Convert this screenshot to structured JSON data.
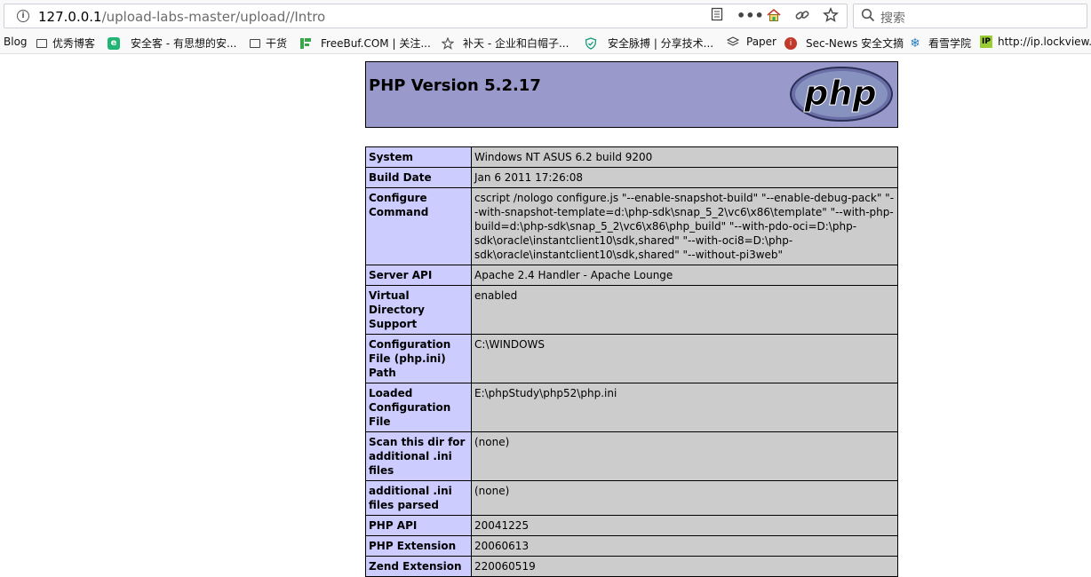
{
  "browser": {
    "url_host": "127.0.0.1",
    "url_path": "/upload-labs-master/upload//Intro",
    "search_placeholder": "搜索",
    "bookmarks": [
      {
        "label": "Blog",
        "icon": "none"
      },
      {
        "label": "优秀博客",
        "icon": "folder-icon"
      },
      {
        "label": "安全客 - 有思想的安...",
        "icon": "anquanke-icon"
      },
      {
        "label": "干货",
        "icon": "folder-icon"
      },
      {
        "label": "FreeBuf.COM | 关注...",
        "icon": "freebuf-icon"
      },
      {
        "label": "补天 - 企业和白帽子...",
        "icon": "butian-icon"
      },
      {
        "label": "安全脉搏 | 分享技术...",
        "icon": "secpulse-icon"
      },
      {
        "label": "Paper",
        "icon": "paper-icon"
      },
      {
        "label": "Sec-News 安全文摘",
        "icon": "secnews-icon"
      },
      {
        "label": "看雪学院",
        "icon": "kanxue-icon"
      },
      {
        "label": "http://ip.lockview.c",
        "icon": "ip-icon"
      }
    ]
  },
  "phpinfo": {
    "title": "PHP Version 5.2.17",
    "logo_text": "php",
    "rows": [
      {
        "key": "System",
        "value": "Windows NT ASUS 6.2 build 9200"
      },
      {
        "key": "Build Date",
        "value": "Jan 6 2011 17:26:08"
      },
      {
        "key": "Configure Command",
        "value": "cscript /nologo configure.js \"--enable-snapshot-build\" \"--enable-debug-pack\" \"--with-snapshot-template=d:\\php-sdk\\snap_5_2\\vc6\\x86\\template\" \"--with-php-build=d:\\php-sdk\\snap_5_2\\vc6\\x86\\php_build\" \"--with-pdo-oci=D:\\php-sdk\\oracle\\instantclient10\\sdk,shared\" \"--with-oci8=D:\\php-sdk\\oracle\\instantclient10\\sdk,shared\" \"--without-pi3web\""
      },
      {
        "key": "Server API",
        "value": "Apache 2.4 Handler - Apache Lounge"
      },
      {
        "key": "Virtual Directory Support",
        "value": "enabled"
      },
      {
        "key": "Configuration File (php.ini) Path",
        "value": "C:\\WINDOWS"
      },
      {
        "key": "Loaded Configuration File",
        "value": "E:\\phpStudy\\php52\\php.ini"
      },
      {
        "key": "Scan this dir for additional .ini files",
        "value": "(none)"
      },
      {
        "key": "additional .ini files parsed",
        "value": "(none)"
      },
      {
        "key": "PHP API",
        "value": "20041225"
      },
      {
        "key": "PHP Extension",
        "value": "20060613"
      },
      {
        "key": "Zend Extension",
        "value": "220060519"
      }
    ]
  },
  "colors": {
    "header_bg": "#9999cc",
    "key_bg": "#ccccff",
    "value_bg": "#cccccc"
  }
}
